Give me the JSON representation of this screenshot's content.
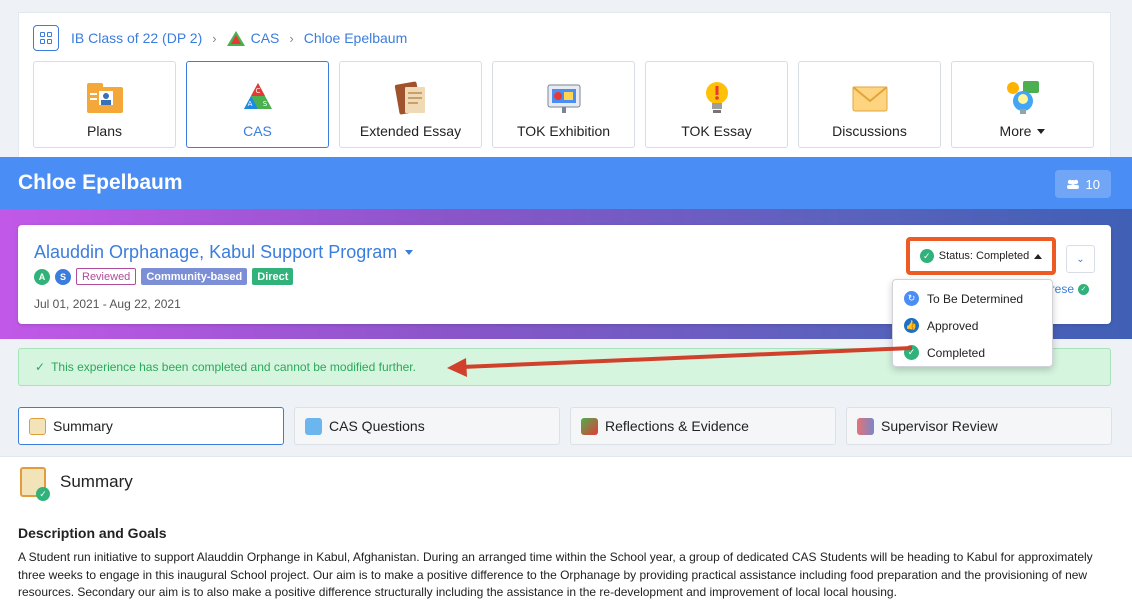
{
  "breadcrumb": {
    "class_name": "IB Class of 22 (DP 2)",
    "section": "CAS",
    "student": "Chloe Epelbaum"
  },
  "nav_tiles": [
    {
      "label": "Plans",
      "icon": "plans-icon"
    },
    {
      "label": "CAS",
      "icon": "cas-icon"
    },
    {
      "label": "Extended Essay",
      "icon": "extended-essay-icon"
    },
    {
      "label": "TOK Exhibition",
      "icon": "tok-exhibition-icon"
    },
    {
      "label": "TOK Essay",
      "icon": "tok-essay-icon"
    },
    {
      "label": "Discussions",
      "icon": "discussions-icon"
    },
    {
      "label": "More",
      "icon": "more-icon"
    }
  ],
  "header": {
    "student_name": "Chloe Epelbaum",
    "member_count": "10"
  },
  "experience": {
    "title": "Alauddin Orphanage, Kabul Support Program",
    "strand_badges": [
      "A",
      "S"
    ],
    "tags": {
      "reviewed": "Reviewed",
      "community": "Community-based",
      "direct": "Direct"
    },
    "dates": "Jul 01, 2021 - Aug 22, 2021",
    "status_label": "Status: Completed",
    "supervisor_partial": "arese"
  },
  "status_menu": {
    "items": [
      "To Be Determined",
      "Approved",
      "Completed"
    ]
  },
  "alert": {
    "message": "This experience has been completed and cannot be modified further."
  },
  "tabs": [
    "Summary",
    "CAS Questions",
    "Reflections & Evidence",
    "Supervisor Review"
  ],
  "summary": {
    "heading": "Summary",
    "description_title": "Description and Goals",
    "description": "A Student run initiative to support Alauddin Orphange in Kabul, Afghanistan. During an arranged time within the School year, a group of dedicated CAS Students will be heading to Kabul for approximately three weeks to engage in this inaugural School project. Our aim is to make a positive difference to the Orphanage by providing practical assistance including food preparation and the provisioning of new resources. Secondary our aim is to also make a positive difference structurally including the assistance in the re-development and improvement of local local housing."
  },
  "colors": {
    "accent": "#3b7ddd",
    "header_band": "#4a8ef5",
    "highlight_border": "#ee5a24",
    "success": "#30b27a",
    "annotation_arrow": "#d0402a"
  }
}
